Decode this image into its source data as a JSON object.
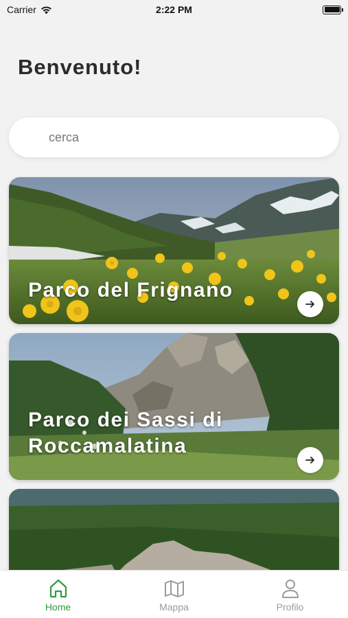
{
  "status_bar": {
    "carrier": "Carrier",
    "time": "2:22 PM",
    "icons": [
      "wifi-icon",
      "battery-icon"
    ]
  },
  "greeting": "Benvenuto!",
  "search": {
    "placeholder": "cerca",
    "value": ""
  },
  "cards": [
    {
      "title": "Parco del Frignano",
      "action_icon": "arrow-right-icon"
    },
    {
      "title": "Parco dei Sassi di Roccamalatina",
      "action_icon": "arrow-right-icon"
    },
    {
      "title": "",
      "action_icon": "arrow-right-icon"
    }
  ],
  "tab_bar": {
    "items": [
      {
        "label": "Home",
        "icon": "home-icon",
        "active": true
      },
      {
        "label": "Mappa",
        "icon": "map-icon",
        "active": false
      },
      {
        "label": "Profilo",
        "icon": "profile-icon",
        "active": false
      }
    ]
  },
  "colors": {
    "accent": "#2e9c3a",
    "inactive_tab": "#9a9a9a",
    "background": "#f2f2f2"
  }
}
